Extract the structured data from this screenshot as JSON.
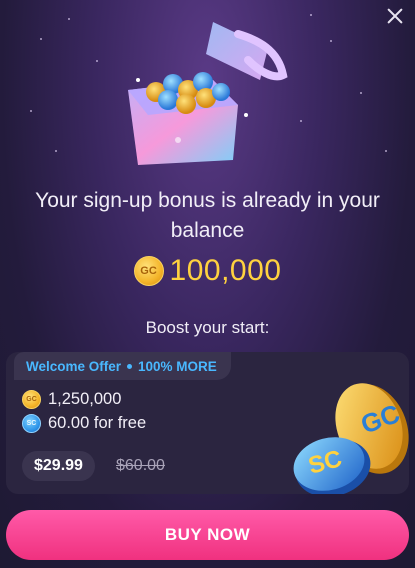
{
  "headline": "Your sign-up bonus is already in your balance",
  "bonus": {
    "coin_label": "GC",
    "amount": "100,000"
  },
  "boost_label": "Boost your start:",
  "offer": {
    "title": "Welcome Offer",
    "extra": "100% MORE",
    "gc_coin_label": "GC",
    "gc_amount": "1,250,000",
    "sc_coin_label": "SC",
    "sc_amount": "60.00 for free",
    "price": "$29.99",
    "old_price": "$60.00",
    "art_coin_gc": "GC",
    "art_coin_sc": "SC"
  },
  "buy_button": "BUY NOW",
  "colors": {
    "accent_pink": "#f0317f",
    "gold": "#ffd23f",
    "offer_blue": "#49b8ff",
    "background": "#231b3c"
  },
  "icons": [
    "close-icon",
    "gift-box-icon",
    "gc-coin-icon",
    "sc-coin-icon"
  ]
}
